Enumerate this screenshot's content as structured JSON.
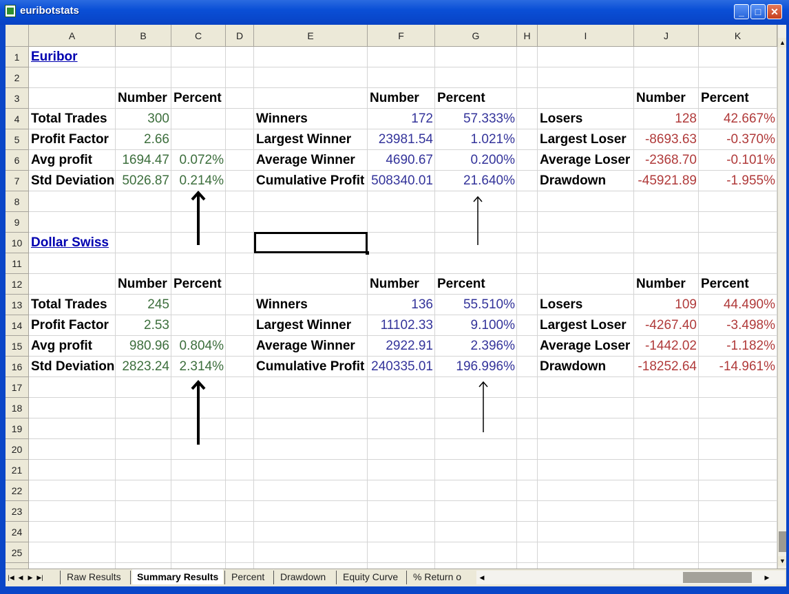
{
  "window": {
    "title": "euribotstats"
  },
  "columns": [
    "A",
    "B",
    "C",
    "D",
    "E",
    "F",
    "G",
    "H",
    "I",
    "J",
    "K"
  ],
  "rows": [
    "1",
    "2",
    "3",
    "4",
    "5",
    "6",
    "7",
    "8",
    "9",
    "10",
    "11",
    "12",
    "13",
    "14",
    "15",
    "16",
    "17",
    "18",
    "19",
    "20",
    "21",
    "22",
    "23",
    "24",
    "25"
  ],
  "euribor": {
    "title": "Euribor",
    "stats": {
      "header_number": "Number",
      "header_percent": "Percent",
      "rows": [
        {
          "label": "Total Trades",
          "number": "300",
          "percent": ""
        },
        {
          "label": "Profit Factor",
          "number": "2.66",
          "percent": ""
        },
        {
          "label": "Avg profit",
          "number": "1694.47",
          "percent": "0.072%"
        },
        {
          "label": "Std Deviation",
          "number": "5026.87",
          "percent": "0.214%"
        }
      ]
    },
    "winners": {
      "header_number": "Number",
      "header_percent": "Percent",
      "rows": [
        {
          "label": "Winners",
          "number": "172",
          "percent": "57.333%"
        },
        {
          "label": "Largest Winner",
          "number": "23981.54",
          "percent": "1.021%"
        },
        {
          "label": "Average Winner",
          "number": "4690.67",
          "percent": "0.200%"
        },
        {
          "label": "Cumulative Profit",
          "number": "508340.01",
          "percent": "21.640%"
        }
      ]
    },
    "losers": {
      "header_number": "Number",
      "header_percent": "Percent",
      "rows": [
        {
          "label": "Losers",
          "number": "128",
          "percent": "42.667%"
        },
        {
          "label": "Largest Loser",
          "number": "-8693.63",
          "percent": "-0.370%"
        },
        {
          "label": "Average Loser",
          "number": "-2368.70",
          "percent": "-0.101%"
        },
        {
          "label": "Drawdown",
          "number": "-45921.89",
          "percent": "-1.955%"
        }
      ]
    }
  },
  "dollar_swiss": {
    "title": "Dollar Swiss",
    "stats": {
      "header_number": "Number",
      "header_percent": "Percent",
      "rows": [
        {
          "label": "Total Trades",
          "number": "245",
          "percent": ""
        },
        {
          "label": "Profit Factor",
          "number": "2.53",
          "percent": ""
        },
        {
          "label": "Avg profit",
          "number": "980.96",
          "percent": "0.804%"
        },
        {
          "label": "Std Deviation",
          "number": "2823.24",
          "percent": "2.314%"
        }
      ]
    },
    "winners": {
      "header_number": "Number",
      "header_percent": "Percent",
      "rows": [
        {
          "label": "Winners",
          "number": "136",
          "percent": "55.510%"
        },
        {
          "label": "Largest Winner",
          "number": "11102.33",
          "percent": "9.100%"
        },
        {
          "label": "Average Winner",
          "number": "2922.91",
          "percent": "2.396%"
        },
        {
          "label": "Cumulative Profit",
          "number": "240335.01",
          "percent": "196.996%"
        }
      ]
    },
    "losers": {
      "header_number": "Number",
      "header_percent": "Percent",
      "rows": [
        {
          "label": "Losers",
          "number": "109",
          "percent": "44.490%"
        },
        {
          "label": "Largest Loser",
          "number": "-4267.40",
          "percent": "-3.498%"
        },
        {
          "label": "Average Loser",
          "number": "-1442.02",
          "percent": "-1.182%"
        },
        {
          "label": "Drawdown",
          "number": "-18252.64",
          "percent": "-14.961%"
        }
      ]
    }
  },
  "sheet_tabs": [
    {
      "label": "Raw Results",
      "active": false
    },
    {
      "label": "Summary Results",
      "active": true
    },
    {
      "label": "Percent",
      "active": false
    },
    {
      "label": "Drawdown",
      "active": false
    },
    {
      "label": "Equity Curve",
      "active": false
    },
    {
      "label": "% Return o",
      "active": false
    }
  ],
  "colors": {
    "label_text": "#000000",
    "stats_numbers": "#3c6e3c",
    "winner_numbers": "#33339a",
    "loser_numbers": "#b03a3a",
    "link": "#0000b0"
  },
  "icons": {
    "app": "excel-sheet-icon",
    "minimize": "minimize-icon",
    "maximize": "maximize-icon",
    "close": "close-icon",
    "annotation": "up-arrow-icon"
  }
}
